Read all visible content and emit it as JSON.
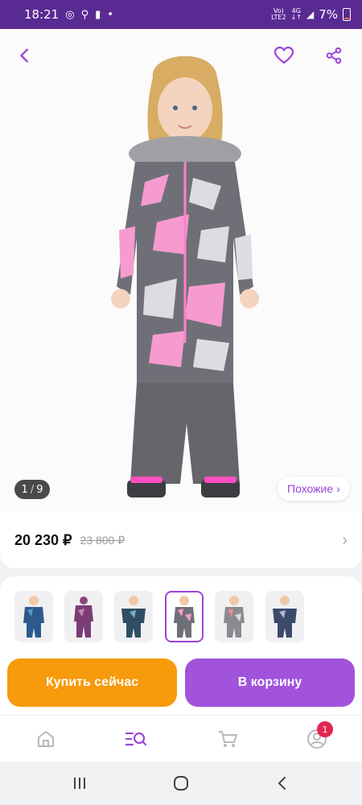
{
  "status_bar": {
    "time": "18:21",
    "network_top": "Vo)",
    "network_bottom": "LTE2",
    "data_top": "4G",
    "data_bottom": "↓↑",
    "battery": "7%"
  },
  "hero": {
    "back_icon": "chevron-left-icon",
    "favorite_icon": "heart-icon",
    "share_icon": "share-icon",
    "counter_current": "1",
    "counter_separator": "/",
    "counter_total": "9",
    "similar_label": "Похожие",
    "similar_chevron": "›"
  },
  "price": {
    "current": "20 230 ₽",
    "old": "23 800 ₽",
    "chevron": "›"
  },
  "thumbnails": [
    {
      "name": "blue"
    },
    {
      "name": "purple"
    },
    {
      "name": "teal"
    },
    {
      "name": "pink-grey",
      "active": true
    },
    {
      "name": "grey-pink"
    },
    {
      "name": "navy"
    }
  ],
  "actions": {
    "buy_label": "Купить сейчас",
    "cart_label": "В корзину"
  },
  "bottom_nav": {
    "items": [
      "home-icon",
      "catalog-search-icon",
      "cart-icon",
      "profile-icon"
    ],
    "profile_badge": "1"
  },
  "system_nav": [
    "recent-apps-icon",
    "home-circle-icon",
    "back-icon"
  ],
  "colors": {
    "accent": "#9b45d9",
    "status_bar": "#5a2a93",
    "buy": "#f79a0b",
    "cart": "#a153dc",
    "badge": "#e2264d"
  }
}
